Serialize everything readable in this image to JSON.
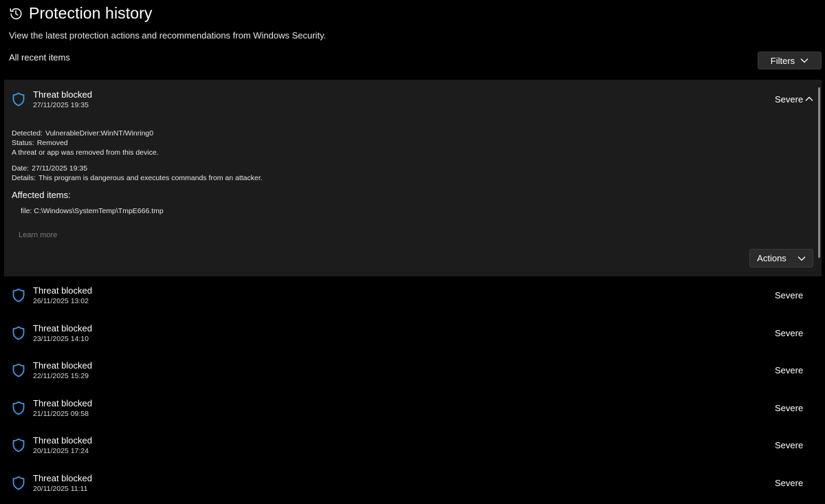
{
  "header": {
    "title": "Protection history",
    "subtitle": "View the latest protection actions and recommendations from Windows Security."
  },
  "section_label": "All recent items",
  "filters_label": "Filters",
  "expanded_item": {
    "title": "Threat blocked",
    "date": "27/11/2025 19:35",
    "severity": "Severe",
    "detected_label": "Detected:",
    "detected_value": "VulnerableDriver:WinNT/Winring0",
    "status_label": "Status:",
    "status_value": "Removed",
    "status_description": "A threat or app was removed from this device.",
    "date_label": "Date:",
    "date_value": "27/11/2025 19:35",
    "details_label": "Details:",
    "details_value": "This program is dangerous and executes commands from an attacker.",
    "affected_heading": "Affected items:",
    "affected_item": "file: C:\\Windows\\SystemTemp\\TmpE666.tmp",
    "learn_more": "Learn more",
    "actions_label": "Actions"
  },
  "items": [
    {
      "title": "Threat blocked",
      "date": "26/11/2025 13:02",
      "severity": "Severe"
    },
    {
      "title": "Threat blocked",
      "date": "23/11/2025 14:10",
      "severity": "Severe"
    },
    {
      "title": "Threat blocked",
      "date": "22/11/2025 15:29",
      "severity": "Severe"
    },
    {
      "title": "Threat blocked",
      "date": "21/11/2025 09:58",
      "severity": "Severe"
    },
    {
      "title": "Threat blocked",
      "date": "20/11/2025 17:24",
      "severity": "Severe"
    },
    {
      "title": "Threat blocked",
      "date": "20/11/2025 11:11",
      "severity": "Severe"
    }
  ],
  "colors": {
    "background": "#000000",
    "panel": "#1c1c1c",
    "button": "#2b2b2b",
    "shield_accent": "#3b9ce8",
    "muted_link": "#7a7a7a"
  },
  "icons": {
    "header": "history-clock-icon",
    "row": "shield-icon",
    "dropdown": "chevron-down-icon",
    "collapse": "chevron-up-icon"
  }
}
